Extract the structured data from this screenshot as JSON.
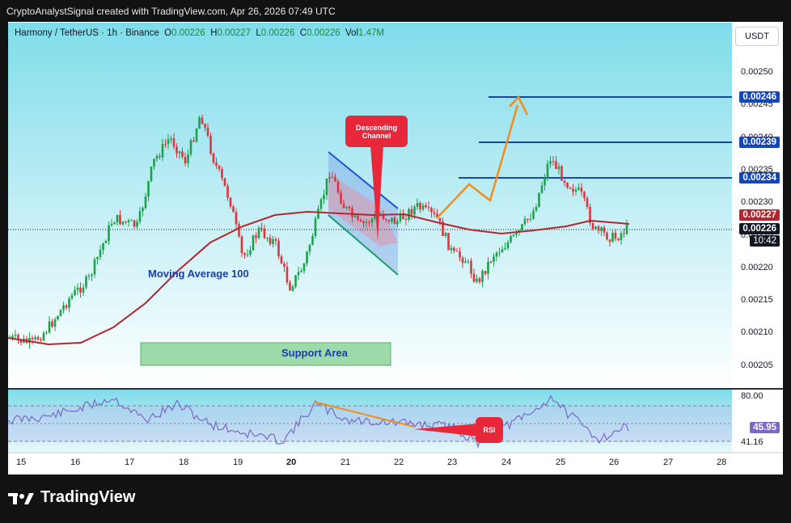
{
  "header": {
    "caption": "CryptoAnalystSignal created with TradingView.com, Apr 26, 2026 07:49 UTC"
  },
  "legend": {
    "symbol": "Harmony / TetherUS · 1h · Binance",
    "o_label": "O",
    "o_value": "0.00226",
    "h_label": "H",
    "h_value": "0.00227",
    "l_label": "L",
    "l_value": "0.00226",
    "c_label": "C",
    "c_value": "0.00226",
    "vol_label": "Vol",
    "vol_value": "1.47M"
  },
  "currency_button": "USDT",
  "price_axis": [
    "0.00250",
    "0.00245",
    "0.00240",
    "0.00235",
    "0.00230",
    "0.00225",
    "0.00220",
    "0.00215",
    "0.00210",
    "0.00205"
  ],
  "price_tags": {
    "r1": "0.00246",
    "r2": "0.00239",
    "r3": "0.00234",
    "ma": "0.00227",
    "last": "0.00226",
    "countdown": "10:42"
  },
  "rsi_axis": {
    "upper": "80.00",
    "value": "45.95",
    "lower": "41.16"
  },
  "time_axis": [
    "15",
    "16",
    "17",
    "18",
    "19",
    "20",
    "21",
    "22",
    "23",
    "24",
    "25",
    "26",
    "27",
    "28"
  ],
  "annotations": {
    "channel": "Descending Channel",
    "moving_average": "Moving Average 100",
    "support": "Support Area",
    "rsi": "RSI"
  },
  "footer": {
    "brand": "TradingView"
  },
  "colors": {
    "chart_bg_top": "#7fdcea",
    "chart_bg_bottom": "#ffffff",
    "bull": "#1aa34a",
    "bear": "#e0343d",
    "ma": "#b2272f",
    "resistance": "#1446b8",
    "arrow": "#f28c1b",
    "callout": "#e8283a"
  }
}
